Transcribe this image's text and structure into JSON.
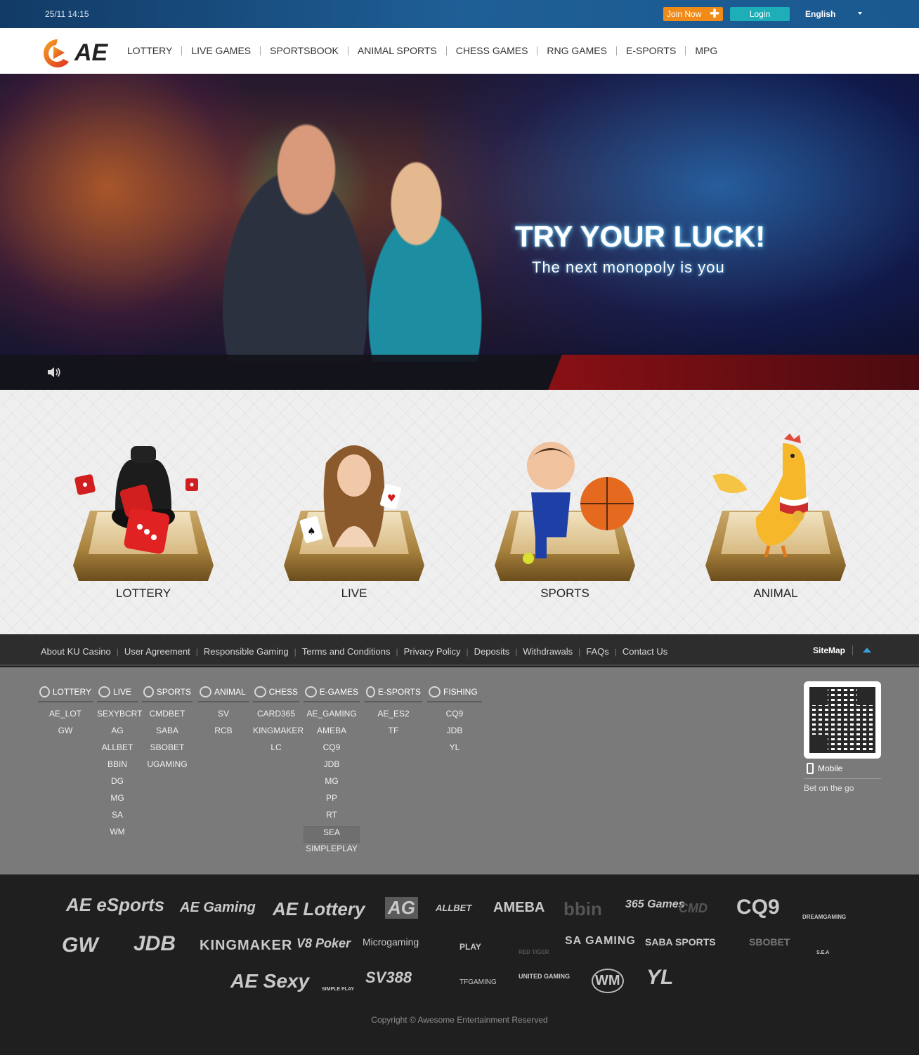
{
  "topbar": {
    "datetime": "25/11 14:15",
    "join_label": "Join Now",
    "login_label": "Login",
    "language": "English"
  },
  "nav": {
    "logo_text": "AE",
    "items": [
      "LOTTERY",
      "LIVE GAMES",
      "SPORTSBOOK",
      "ANIMAL SPORTS",
      "CHESS GAMES",
      "RNG GAMES",
      "E-SPORTS",
      "MPG"
    ]
  },
  "hero": {
    "title": "TRY YOUR LUCK!",
    "subtitle": "The next monopoly is you"
  },
  "categories": [
    "LOTTERY",
    "LIVE",
    "SPORTS",
    "ANIMAL"
  ],
  "footer_links": [
    "About KU Casino",
    "User Agreement",
    "Responsible Gaming",
    "Terms and Conditions",
    "Privacy Policy",
    "Deposits",
    "Withdrawals",
    "FAQs",
    "Contact Us"
  ],
  "sitemap_label": "SiteMap",
  "sitemap": [
    {
      "head": "LOTTERY",
      "icon": "lottery-icon",
      "items": [
        "AE_LOT",
        "GW"
      ]
    },
    {
      "head": "LIVE",
      "icon": "live-icon",
      "items": [
        "SEXYBCRT",
        "AG",
        "ALLBET",
        "BBIN",
        "DG",
        "MG",
        "SA",
        "WM"
      ]
    },
    {
      "head": "SPORTS",
      "icon": "sports-icon",
      "items": [
        "CMDBET",
        "SABA",
        "SBOBET",
        "UGAMING"
      ]
    },
    {
      "head": "ANIMAL",
      "icon": "animal-icon",
      "items": [
        "SV",
        "RCB"
      ]
    },
    {
      "head": "CHESS",
      "icon": "chess-icon",
      "items": [
        "CARD365",
        "KINGMAKER",
        "LC"
      ]
    },
    {
      "head": "E-GAMES",
      "icon": "egames-icon",
      "items": [
        "AE_GAMING",
        "AMEBA",
        "CQ9",
        "JDB",
        "MG",
        "PP",
        "RT",
        "SEA",
        "SIMPLEPLAY"
      ]
    },
    {
      "head": "E-SPORTS",
      "icon": "esports-icon",
      "items": [
        "AE_ES2",
        "TF"
      ]
    },
    {
      "head": "FISHING",
      "icon": "fishing-icon",
      "items": [
        "CQ9",
        "JDB",
        "YL"
      ]
    }
  ],
  "mobile": {
    "label": "Mobile",
    "tagline": "Bet on the go"
  },
  "providers": {
    "row1": [
      "AE eSports",
      "AE Gaming",
      "AE Lottery",
      "AG",
      "ALLBET",
      "AMEBA",
      "bbin",
      "365 Games",
      "CMD",
      "CQ9",
      "DREAMGAMING"
    ],
    "row2": [
      "GW",
      "JDB",
      "KINGMAKER",
      "V8 Poker",
      "Microgaming",
      "PLAY",
      "RED TIGER",
      "SA GAMING",
      "SABA SPORTS",
      "SBOBET",
      "S.E.A"
    ],
    "row3": [
      "AE Sexy",
      "SIMPLE PLAY",
      "SV388",
      "TFGAMING",
      "UNITED GAMING",
      "WM",
      "YL"
    ]
  },
  "copyright": "Copyright © Awesome Entertainment Reserved"
}
